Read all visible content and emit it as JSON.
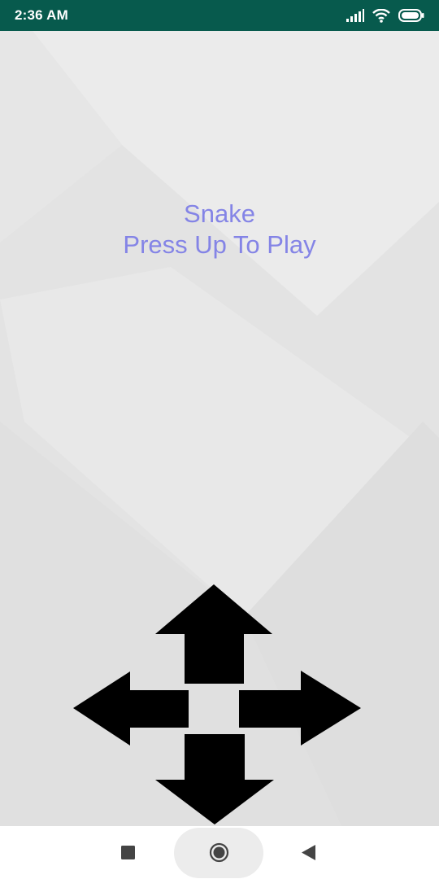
{
  "status_bar": {
    "time": "2:36 AM",
    "icons": [
      "signal-icon",
      "wifi-icon",
      "battery-icon"
    ],
    "background_color": "#075a4d"
  },
  "game": {
    "title": "Snake",
    "subtitle": "Press Up To Play",
    "text_color": "#8484e6",
    "controls": [
      "up-arrow-icon",
      "left-arrow-icon",
      "right-arrow-icon",
      "down-arrow-icon"
    ]
  },
  "nav_bar": {
    "buttons": [
      "recents-square-icon",
      "home-circle-icon",
      "back-triangle-icon"
    ]
  }
}
